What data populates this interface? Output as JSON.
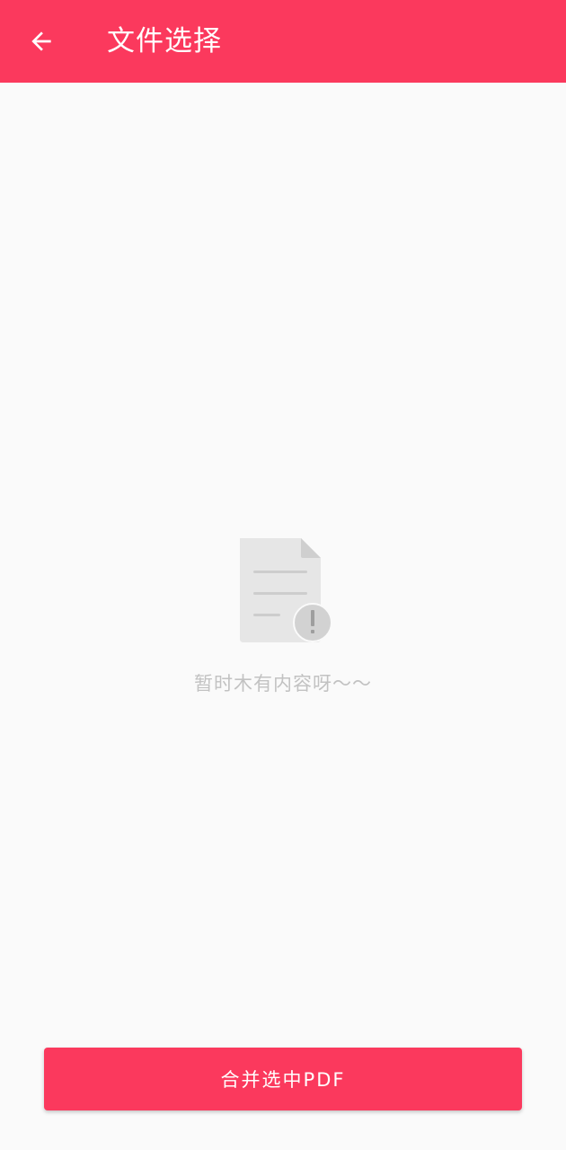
{
  "app_bar": {
    "title": "文件选择",
    "back_icon": "arrow-left-icon",
    "background_color": "#fb395d"
  },
  "empty_state": {
    "icon": "document-alert-icon",
    "message": "暂时木有内容呀～～"
  },
  "footer": {
    "merge_button_label": "合并选中PDF"
  }
}
